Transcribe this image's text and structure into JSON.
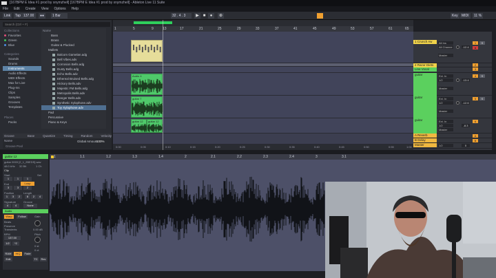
{
  "window": {
    "title": "[167BPM E Idea #1 prod by xnymzhell] [167BPM E Idea #1 prod by xnymzhell] - Ableton Live 11 Suite"
  },
  "menu": [
    "File",
    "Edit",
    "Create",
    "View",
    "Options",
    "Help"
  ],
  "transport": {
    "link": "Link",
    "tap": "Tap",
    "tempo": "137.00",
    "bar": "1 Bar",
    "position": "32 . 4 . 3",
    "key": "Key",
    "midi": "MIDI",
    "cpu": "11 %"
  },
  "browser": {
    "search_placeholder": "Search (Ctrl + F)",
    "collections_header": "Collections",
    "collections": [
      {
        "label": "Favorites",
        "color": "#e0507a"
      },
      {
        "label": "Green",
        "color": "#3cc35a"
      },
      {
        "label": "Blue",
        "color": "#4c8de0"
      }
    ],
    "categories_header": "Categories",
    "categories": [
      "Sounds",
      "Drums",
      "Instruments",
      "Audio Effects",
      "MIDI Effects",
      "Max for Live",
      "Plug-Ins",
      "Clips",
      "Samples",
      "Grooves",
      "Templates"
    ],
    "places_header": "Places",
    "places": [
      "Packs"
    ],
    "files_header": "Name",
    "files": [
      "Bass",
      "Brass",
      "Guitar & Plucked",
      "Mallets",
      "Balcom Gamelan.adg",
      "Bell Vibes.adv",
      "Corrosion Bells.adg",
      "Dusty Bells.adg",
      "Echo Bells.adv",
      "Ethereal Bruised Bells.adg",
      "Hickory Bells.adv",
      "Majestic FM Bells.adg",
      "Metropolis Bells.adv",
      "Ranger Bells.adv",
      "Synthetic Xylophone.adv",
      "Toy Xylophone.adv",
      "Pad",
      "Percussive",
      "Piano & Keys"
    ],
    "groove": {
      "headers": [
        "Groove Name",
        "Base",
        "Quantize",
        "Timing",
        "Random",
        "Velocity"
      ],
      "global_amount_label": "Global Amount",
      "global_amount": "100%",
      "groove_pool": "Groove Pool"
    }
  },
  "ruler": [
    "1",
    "5",
    "9",
    "13",
    "17",
    "21",
    "25",
    "29",
    "33",
    "37",
    "41",
    "45",
    "49",
    "53",
    "57",
    "61",
    "65"
  ],
  "time_ruler": [
    "0:00",
    "0:05",
    "0:10",
    "0:15",
    "0:20",
    "0:25",
    "0:30",
    "0:35",
    "0:40",
    "0:45",
    "0:50",
    "0:55",
    "1:00"
  ],
  "clips": [
    "Audio 4",
    "guitar 7",
    "guitar 12",
    "guitar 12"
  ],
  "mixer": {
    "set_label": "Set",
    "tracks": [
      {
        "name": "1 Crunch Aw",
        "color": "#f0d24a",
        "input": "All Ins",
        "chan": "All Channe",
        "out": "Master",
        "vol": "-12.4",
        "num": "1"
      },
      {
        "name": "2 Razor Diets",
        "color": "#f0d24a",
        "input": "",
        "chan": "",
        "out": "",
        "vol": "",
        "num": "2"
      },
      {
        "name": "Line Vocal",
        "color": "#5bd05e",
        "input": "",
        "chan": "",
        "out": "",
        "vol": "",
        "num": "3"
      },
      {
        "name": "guitar",
        "color": "#5bd05e",
        "input": "Ext. In",
        "chan": "1/2",
        "out": "Master",
        "vol": "-13.4",
        "num": "4"
      },
      {
        "name": "guitar",
        "color": "#5bd05e",
        "input": "Ext. In",
        "chan": "1/2",
        "out": "Master",
        "vol": "-12.6",
        "num": "5"
      },
      {
        "name": "guitar",
        "color": "#5bd05e",
        "input": "Ext. In",
        "chan": "1/2",
        "out": "Master",
        "vol": "-8.3",
        "num": "6"
      },
      {
        "name": "A Reverb",
        "color": "#f0b840",
        "input": "",
        "chan": "",
        "out": "",
        "vol": "",
        "num": "A"
      },
      {
        "name": "B Delay",
        "color": "#f0b840",
        "input": "",
        "chan": "",
        "out": "",
        "vol": "",
        "num": "B"
      },
      {
        "name": "Master",
        "color": "#f0b840",
        "input": "",
        "chan": "1/2",
        "out": "",
        "vol": "0",
        "num": ""
      }
    ]
  },
  "clip_panel": {
    "title": "guitar 12",
    "file": "guitar 0003 [2_1_2BEDS].wav",
    "rate": "48.0 kHz",
    "bits": "32 Bit",
    "channels": "1 Ch",
    "clip_label": "Clip",
    "start_label": "Start",
    "set_label": "Set",
    "end_label": "End",
    "loop_label": "Loop",
    "position_label": "Position",
    "length_label": "Length",
    "signature_label": "Signature",
    "groove_label": "Groove",
    "start": [
      "1",
      "1",
      "1"
    ],
    "end": [
      "3",
      "3",
      "2"
    ],
    "position": [
      "1",
      "3",
      "2"
    ],
    "length": [
      "8",
      "2",
      "4"
    ],
    "signature": [
      "4",
      "4"
    ],
    "groove": "None",
    "audio_label": "Audio",
    "warp_label": "Warp",
    "follow_label": "Follow",
    "gain_label": "Gain",
    "beats_label": "Beats",
    "preserve_label": "Preserve",
    "transients": "Transients",
    "bpm_label": "BPM",
    "bpm": "137.00",
    "gain_value": "0.00 dB",
    "pitch_label": "Pitch",
    "pitch": "0 st",
    "ram_label": "RAM",
    "hiq_label": "HiQ",
    "fade_label": "Fade",
    "mode_a": "1/2",
    "mode_b": "*2",
    "detune": "0 ct",
    "tc_label": "TC",
    "rev_label": "Rev",
    "edit_label": "Edit"
  },
  "sample_ruler": [
    "1",
    "1.1",
    "1.2",
    "1.3",
    "1.4",
    "2",
    "2.1",
    "2.2",
    "2.3",
    "2.4",
    "3",
    "3.1"
  ]
}
